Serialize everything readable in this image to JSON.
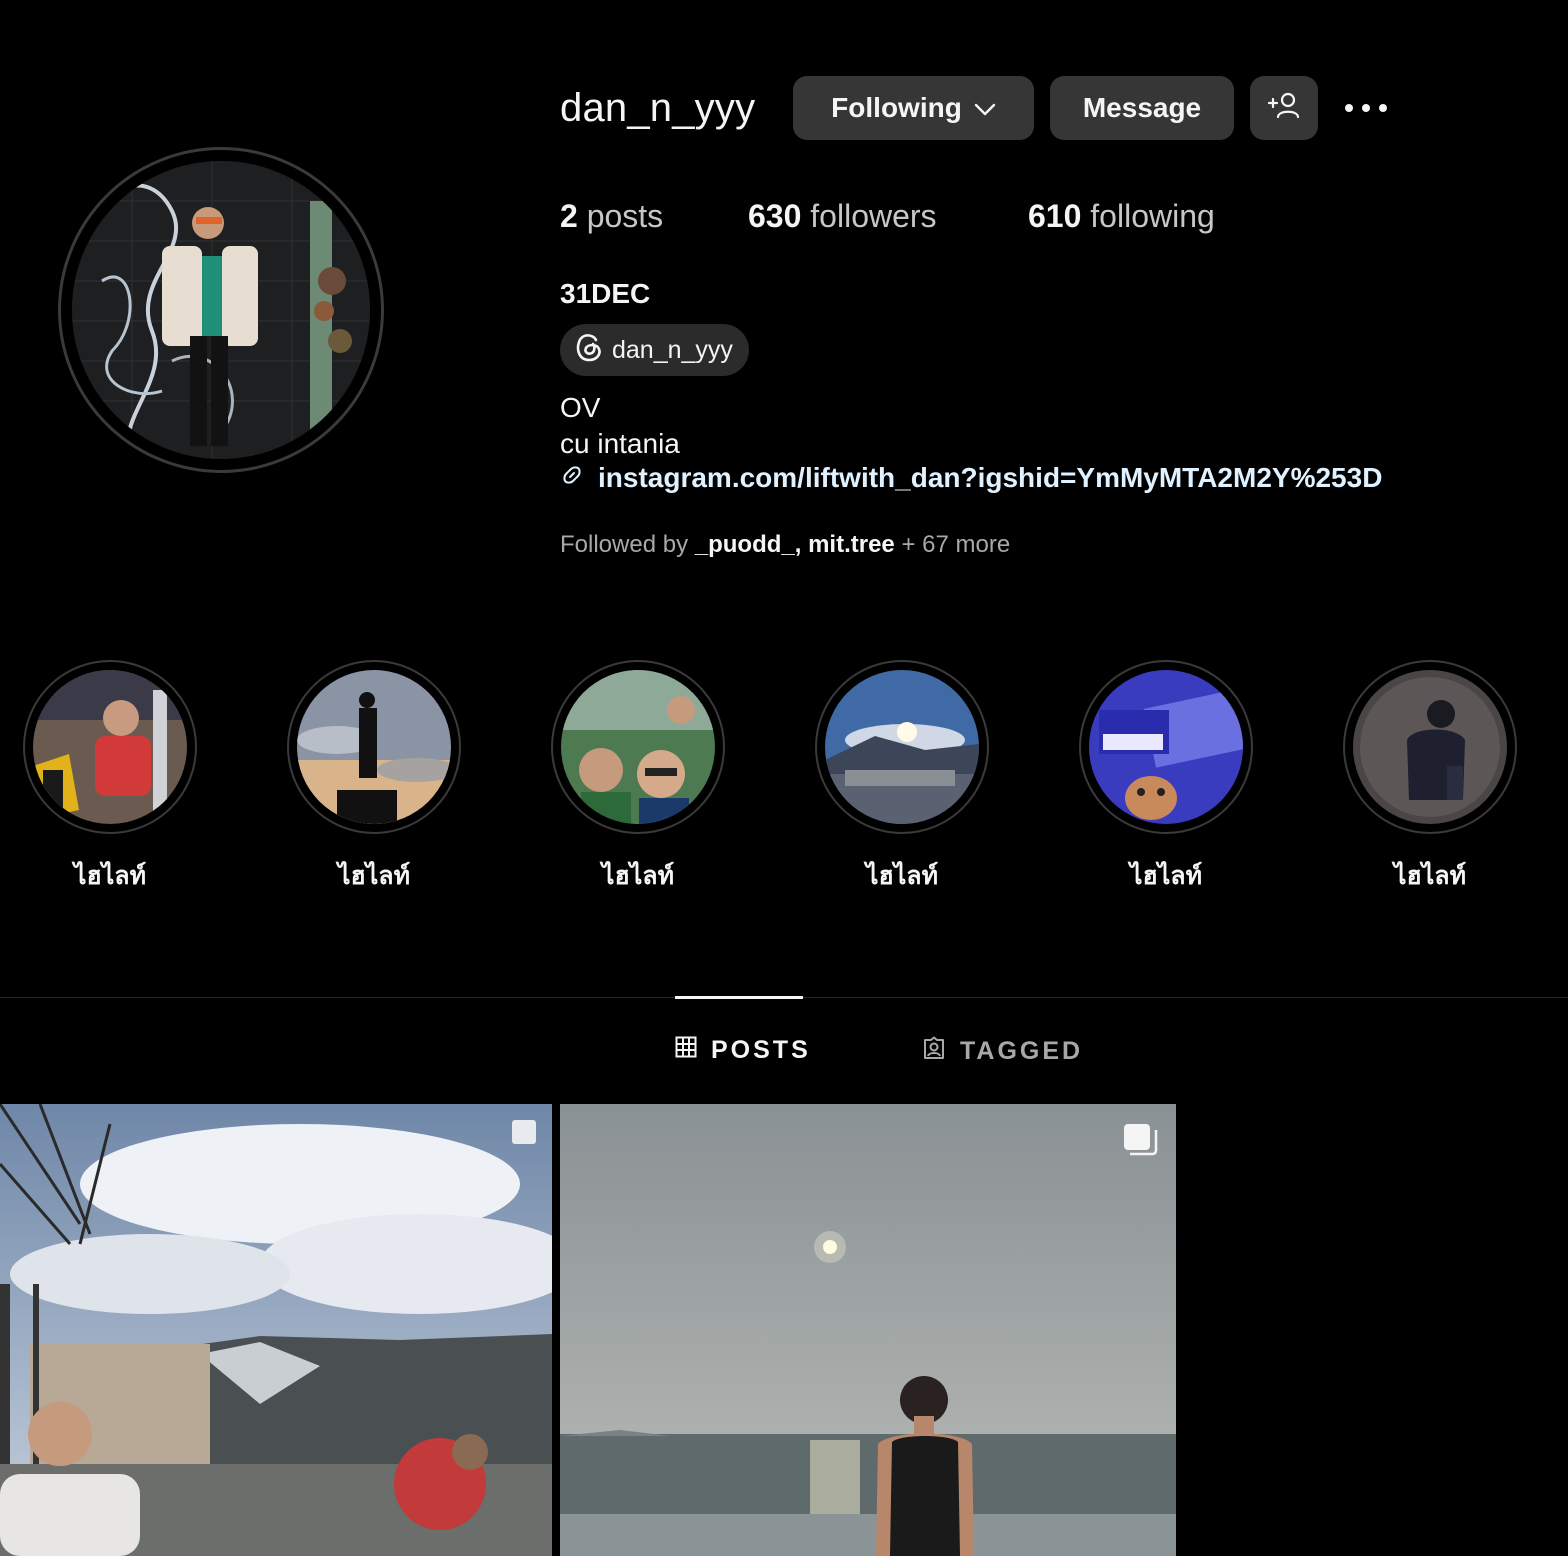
{
  "profile": {
    "username": "dan_n_yyy",
    "full_name": "31DEC",
    "threads_handle": "dan_n_yyy",
    "bio_lines": [
      "OV",
      "cu intania"
    ],
    "link": "instagram.com/liftwith_dan?igshid=YmMyMTA2M2Y%253D"
  },
  "actions": {
    "following_label": "Following",
    "message_label": "Message"
  },
  "stats": {
    "posts_count": "2",
    "posts_label": "posts",
    "followers_count": "630",
    "followers_label": "followers",
    "following_count": "610",
    "following_label": "following"
  },
  "followed_by": {
    "prefix": "Followed by",
    "user1": "_puodd_",
    "separator": ",",
    "user2": "mit.tree",
    "more": "+ 67 more"
  },
  "highlights": [
    {
      "label": "ไฮไลท์"
    },
    {
      "label": "ไฮไลท์"
    },
    {
      "label": "ไฮไลท์"
    },
    {
      "label": "ไฮไลท์"
    },
    {
      "label": "ไฮไลท์"
    },
    {
      "label": "ไฮไลท์"
    }
  ],
  "tabs": {
    "posts": "POSTS",
    "tagged": "TAGGED"
  },
  "icons": {
    "chevron": "chevron-down-icon",
    "add_user": "add-user-icon",
    "more": "more-options-icon",
    "threads": "threads-icon",
    "link": "link-icon",
    "grid": "grid-icon",
    "tagged": "tagged-icon",
    "carousel": "carousel-icon"
  },
  "colors": {
    "background": "#000000",
    "button": "#363636",
    "link": "#e0f1ff",
    "secondary_text": "#a8a8a8"
  }
}
